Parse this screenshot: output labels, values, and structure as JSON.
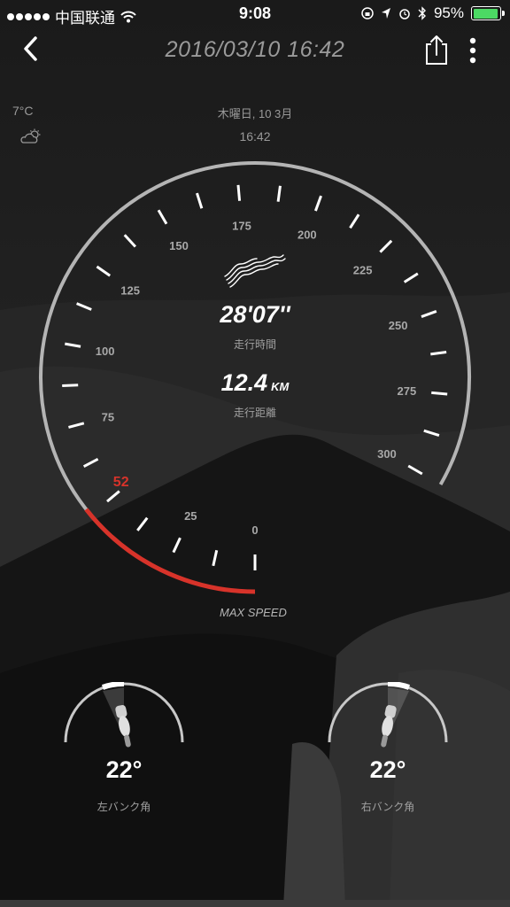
{
  "status_bar": {
    "carrier": "中国联通",
    "time": "9:08",
    "battery_percent": "95%",
    "battery_level": 0.95,
    "battery_color": "#4cd964"
  },
  "nav": {
    "title": "2016/03/10 16:42",
    "back_icon": "chevron-left-icon",
    "share_icon": "share-icon",
    "more_icon": "more-vertical-icon"
  },
  "weather": {
    "temperature": "7°C",
    "icon": "partly-cloudy-icon"
  },
  "date_line": "木曜日, 10 3月",
  "time_line": "16:42",
  "gauge": {
    "ticks": [
      "0",
      "25",
      "52",
      "75",
      "100",
      "125",
      "150",
      "175",
      "200",
      "225",
      "250",
      "275",
      "300"
    ],
    "max_value": 300,
    "max_speed": 52,
    "max_speed_label": "52",
    "accent_color": "#d7332a",
    "track_color": "#b4b4b4"
  },
  "ride": {
    "route_icon": "route-icon",
    "duration": "28'07''",
    "duration_label": "走行時間",
    "distance": "12.4",
    "distance_unit": "KM",
    "distance_label": "走行距離",
    "max_speed_caption": "MAX SPEED"
  },
  "lean_left": {
    "angle": "22°",
    "label": "左バンク角",
    "value_deg": 22
  },
  "lean_right": {
    "angle": "22°",
    "label": "右バンク角",
    "value_deg": 22
  }
}
